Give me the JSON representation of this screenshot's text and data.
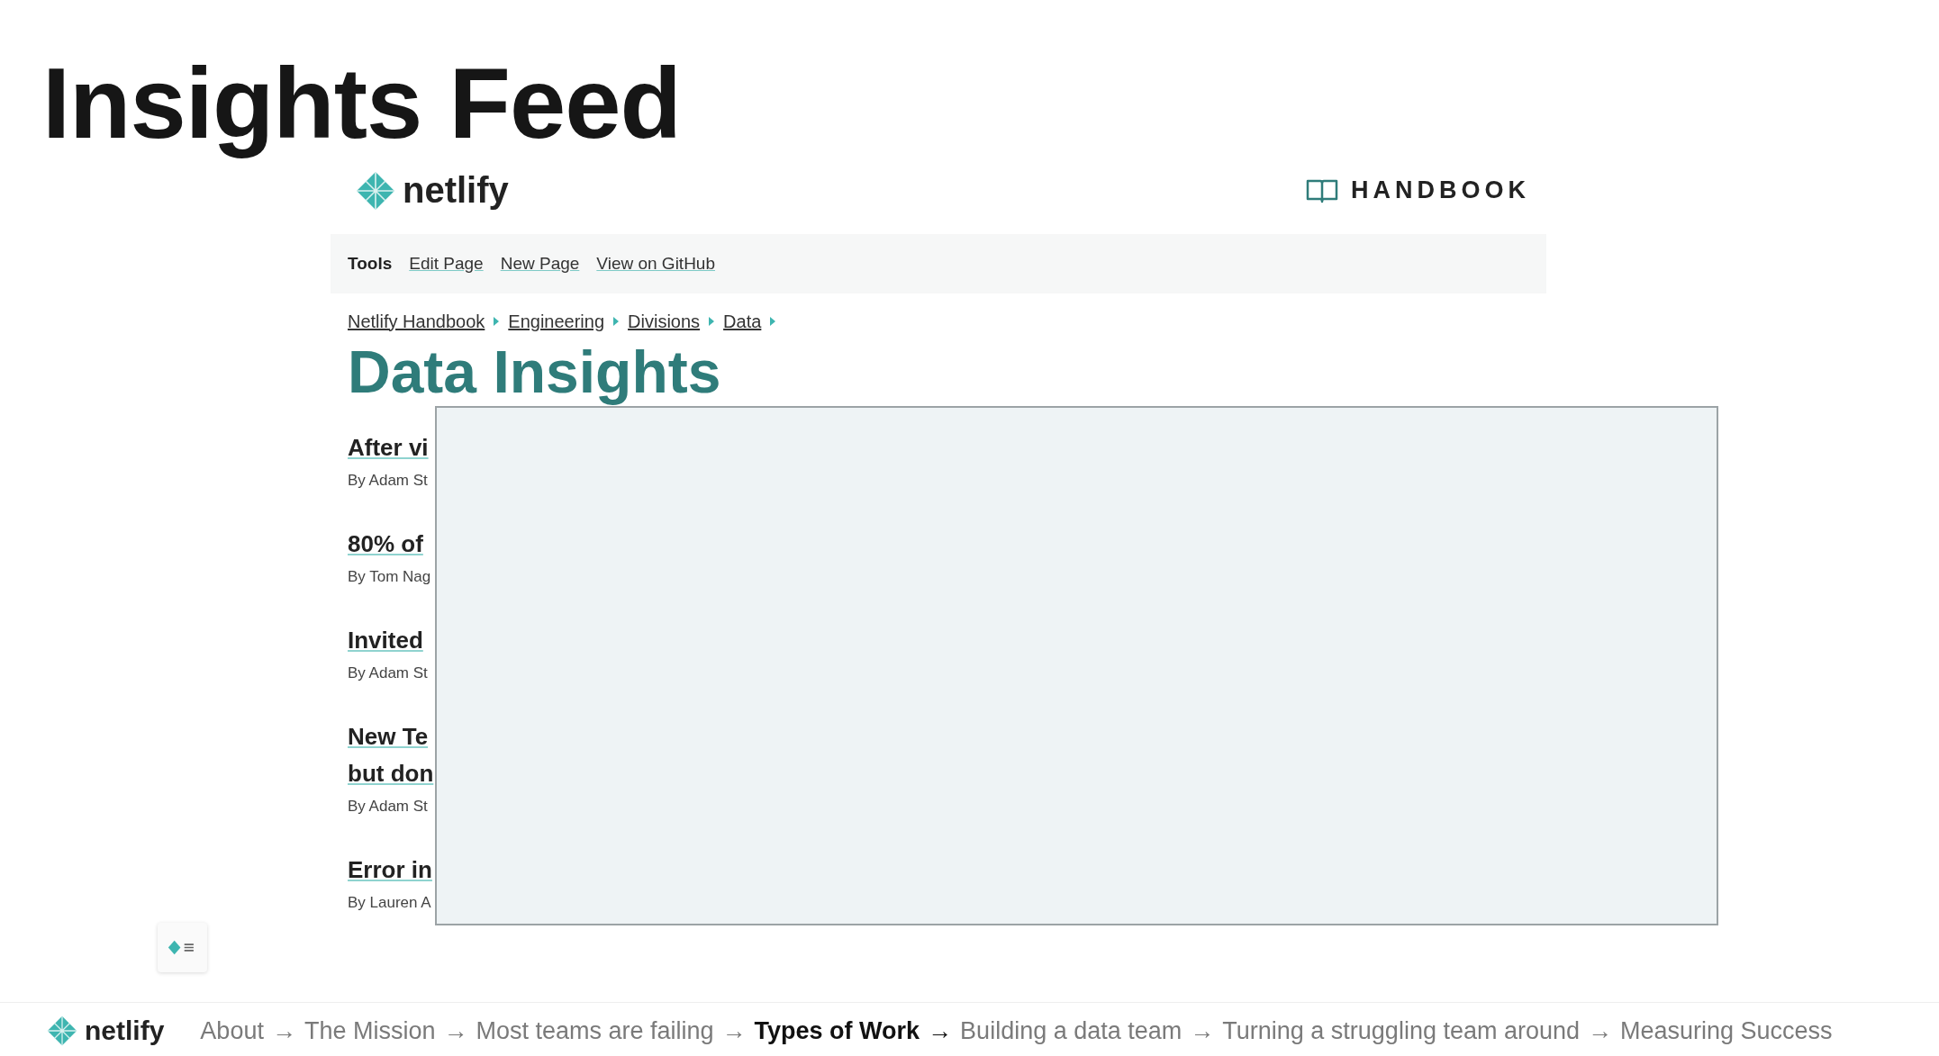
{
  "slide_title": "Insights Feed",
  "site": {
    "brand": "netlify",
    "handbook_label": "HANDBOOK"
  },
  "toolbar": {
    "label": "Tools",
    "links": [
      "Edit Page",
      "New Page",
      "View on GitHub"
    ]
  },
  "breadcrumbs": [
    "Netlify Handbook",
    "Engineering",
    "Divisions",
    "Data"
  ],
  "page_heading": "Data Insights",
  "posts": [
    {
      "lines": [
        "After vi"
      ],
      "byline": "By Adam St"
    },
    {
      "lines": [
        "80% of"
      ],
      "byline": "By Tom Nag"
    },
    {
      "lines": [
        "Invited"
      ],
      "byline": "By Adam St"
    },
    {
      "lines": [
        "New Te",
        "but don"
      ],
      "byline": "By Adam St"
    },
    {
      "lines": [
        "Error in"
      ],
      "byline": "By Lauren A"
    }
  ],
  "footer": {
    "brand": "netlify",
    "nav": [
      {
        "label": "About",
        "arrow": "→",
        "selected": false
      },
      {
        "label": "The Mission",
        "arrow": "→",
        "selected": false
      },
      {
        "label": "Most teams are failing",
        "arrow": "→",
        "selected": false
      },
      {
        "label": "Types of Work",
        "arrow": "→",
        "selected": true
      },
      {
        "label": "Building a data team",
        "arrow": "→",
        "selected": false
      },
      {
        "label": "Turning a struggling team around",
        "arrow": "→",
        "selected": false
      },
      {
        "label": "Measuring Success",
        "selected": false
      }
    ]
  }
}
